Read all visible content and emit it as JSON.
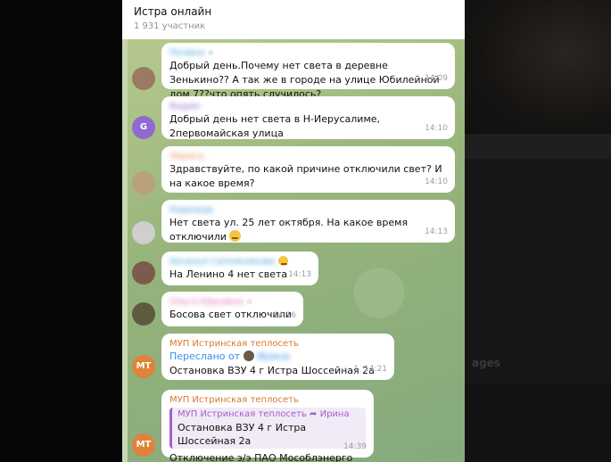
{
  "chat": {
    "title": "Истра онлайн",
    "members": "1 931 участник"
  },
  "messages": [
    {
      "sender": "Полина",
      "text": "Добрый день.Почему нет света в деревне Зенькино?? А так же в городе на улице Юбилейной дом 7??что опять случилось?",
      "time": "14:09",
      "avatar_color": "#9a7a63",
      "name_color": "#3a9ad9"
    },
    {
      "sender": "Вадим",
      "text": "Добрый день нет света в Н-Иерусалиме, 2первомайская улица",
      "time": "14:10",
      "avatar_letter": "G",
      "avatar_color": "#8f6bd1",
      "name_color": "#8f6bd1"
    },
    {
      "sender": "Лариса",
      "text": "Здравствуйте, по какой причине отключили свет? И на какое время?",
      "time": "14:10",
      "avatar_color": "#b9a27a",
      "name_color": "#e3914a"
    },
    {
      "sender": "Надежда",
      "text": "Нет света ул. 25 лет октября. На какое время отключили",
      "time": "14:13",
      "avatar_color": "#cfcfcf",
      "name_color": "#3a9ad9"
    },
    {
      "sender": "Аксинья Сапожникова",
      "text": "На Ленино 4 нет света",
      "time": "14:13",
      "avatar_color": "#7d5a4e",
      "name_color": "#3a9ad9"
    },
    {
      "sender": "Ольга Юрьевна",
      "text": "Босова свет отключили",
      "time": "14:16",
      "avatar_color": "#5e5a40",
      "name_color": "#d86db5"
    },
    {
      "sender": "МУП Истринская теплосеть",
      "forwarded_prefix": "Переслано от",
      "forwarded_from": "Ирина",
      "text": "Остановка ВЗУ 4 г Истра Шоссейная 2а",
      "time": "14:21",
      "reactions": "1",
      "avatar_letter": "MT",
      "avatar_color": "#e0823a",
      "name_color": "#d9772e"
    },
    {
      "sender": "МУП Истринская теплосеть",
      "reply_header": "МУП Истринская теплосеть ➦ Ирина",
      "reply_text": "Остановка ВЗУ 4 г Истра Шоссейная 2а",
      "text": "Отключение э/э ПАО Мособлэнерго",
      "time": "14:39",
      "avatar_letter": "MT",
      "avatar_color": "#e0823a",
      "name_color": "#d9772e"
    }
  ],
  "background_text": "ages"
}
